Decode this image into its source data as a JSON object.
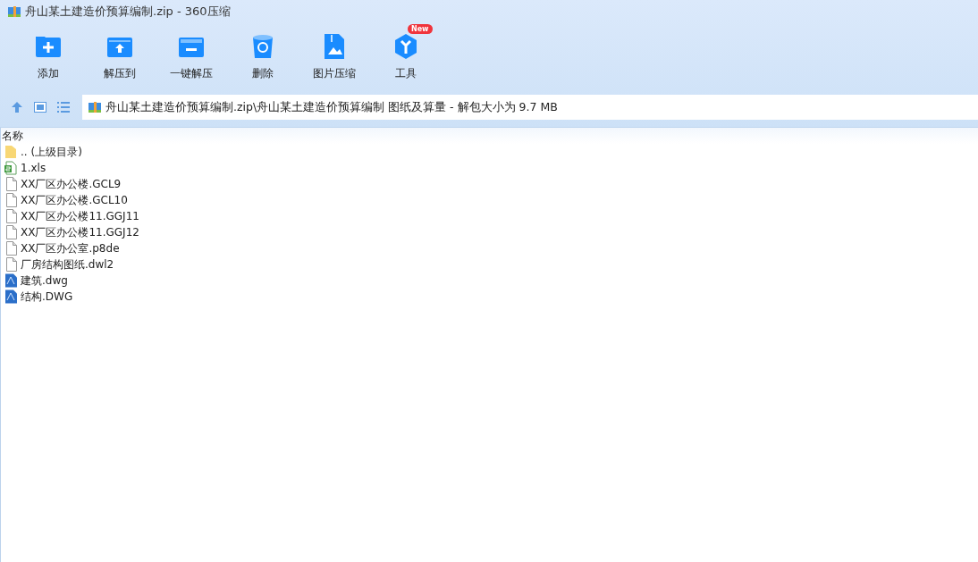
{
  "window": {
    "title": "舟山某土建造价预算编制.zip - 360压缩"
  },
  "toolbar": [
    {
      "label": "添加",
      "kind": "add"
    },
    {
      "label": "解压到",
      "kind": "extract"
    },
    {
      "label": "一键解压",
      "kind": "onekey"
    },
    {
      "label": "删除",
      "kind": "delete"
    },
    {
      "label": "图片压缩",
      "kind": "image"
    },
    {
      "label": "工具",
      "kind": "tools",
      "badge": "New"
    }
  ],
  "address_bar": {
    "path": "舟山某土建造价预算编制.zip\\舟山某土建造价预算编制 图纸及算量 - 解包大小为 9.7 MB"
  },
  "file_list": {
    "columns": [
      "名称"
    ],
    "rows": [
      {
        "name": ".. (上级目录)",
        "kind": "folder"
      },
      {
        "name": "1.xls",
        "kind": "xls"
      },
      {
        "name": "XX厂区办公楼.GCL9",
        "kind": "file"
      },
      {
        "name": "XX厂区办公楼.GCL10",
        "kind": "file"
      },
      {
        "name": "XX厂区办公楼11.GGJ11",
        "kind": "file"
      },
      {
        "name": "XX厂区办公楼11.GGJ12",
        "kind": "file"
      },
      {
        "name": "XX厂区办公室.p8de",
        "kind": "file"
      },
      {
        "name": "厂房结构图纸.dwl2",
        "kind": "file"
      },
      {
        "name": "建筑.dwg",
        "kind": "dwg"
      },
      {
        "name": "结构.DWG",
        "kind": "dwg"
      }
    ]
  }
}
